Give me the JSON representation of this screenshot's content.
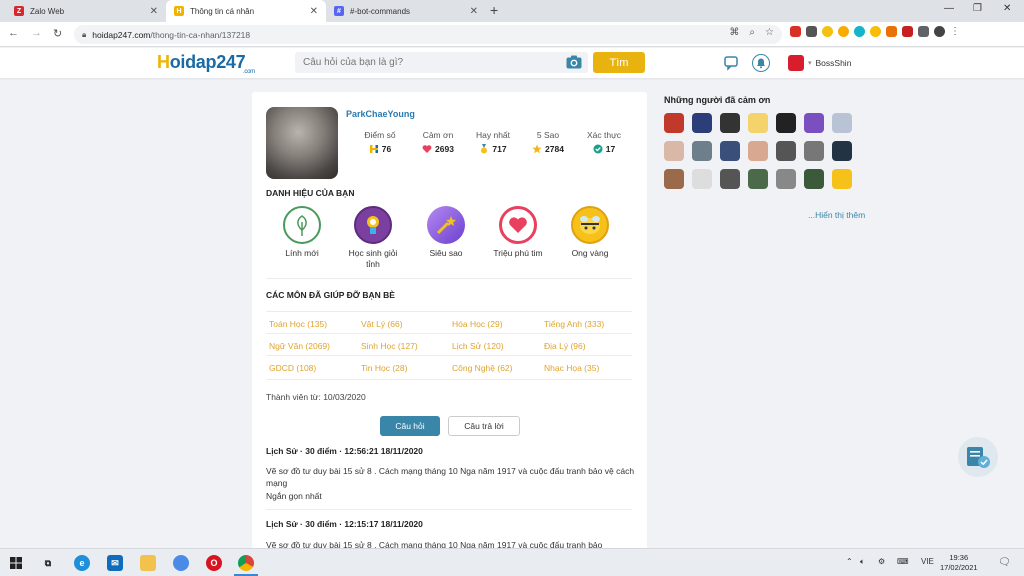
{
  "browser": {
    "tabs": [
      {
        "title": "Zalo Web",
        "active": false
      },
      {
        "title": "Thông tin cá nhân",
        "active": true
      },
      {
        "title": "#-bot-commands",
        "active": false
      }
    ],
    "url_host": "hoidap247.com",
    "url_path": "/thong-tin-ca-nhan/137218"
  },
  "site": {
    "logo_h": "H",
    "logo_rest": "oidap247",
    "logo_suffix": ".com",
    "search_placeholder": "Câu hỏi của bạn là gì?",
    "search_button": "Tìm",
    "username": "BossShin"
  },
  "profile": {
    "name": "ParkChaeYoung",
    "stats": [
      {
        "label": "Điểm số",
        "value": "76",
        "icon": "h-logo-icon"
      },
      {
        "label": "Cảm ơn",
        "value": "2693",
        "icon": "heart-icon"
      },
      {
        "label": "Hay nhất",
        "value": "717",
        "icon": "medal-icon"
      },
      {
        "label": "5 Sao",
        "value": "2784",
        "icon": "star-icon"
      },
      {
        "label": "Xác thực",
        "value": "17",
        "icon": "verified-icon"
      }
    ],
    "badges_title": "DANH HIỆU CỦA BẠN",
    "badges": [
      {
        "label": "Lính mới",
        "color": "#ffffff"
      },
      {
        "label": "Học sinh giỏi tỉnh",
        "color": "#7b3fa0"
      },
      {
        "label": "Siêu sao",
        "color": "#8b4fcf"
      },
      {
        "label": "Triệu phú tim",
        "color": "#e8405e"
      },
      {
        "label": "Ong vàng",
        "color": "#f6c21a"
      }
    ],
    "subjects_title": "CÁC MÔN ĐÃ GIÚP ĐỠ BẠN BÈ",
    "subjects": [
      "Toán Học (135)",
      "Vật Lý (66)",
      "Hóa Học (29)",
      "Tiếng Anh (333)",
      "Ngữ Văn (2069)",
      "Sinh Học (127)",
      "Lịch Sử (120)",
      "Địa Lý (96)",
      "GDCD (108)",
      "Tin Học (28)",
      "Công Nghệ (62)",
      "Nhạc Họa (35)"
    ],
    "member_since": "Thành viên từ: 10/03/2020",
    "tab_questions": "Câu hỏi",
    "tab_answers": "Câu trả lời",
    "questions": [
      {
        "meta": "Lịch Sử · 30 điểm · 12:56:21 18/11/2020",
        "text": "Vẽ sơ đồ tư duy bài 15 sử 8 . Cách mạng tháng 10 Nga năm 1917 và cuộc đấu tranh bảo vệ cách mạng",
        "note": "Ngắn gọn nhất"
      },
      {
        "meta": "Lịch Sử · 30 điểm · 12:15:17 18/11/2020",
        "text": "Vẽ sơ đồ tư duy bài 15 sử 8 . Cách mạng tháng 10 Nga năm 1917 và cuộc đấu tranh bảo"
      }
    ]
  },
  "sidebar": {
    "title": "Những người đã cảm ơn",
    "show_more": "...Hiển thị thêm"
  },
  "taskbar": {
    "lang": "VIE",
    "time": "19:36",
    "date": "17/02/2021"
  }
}
